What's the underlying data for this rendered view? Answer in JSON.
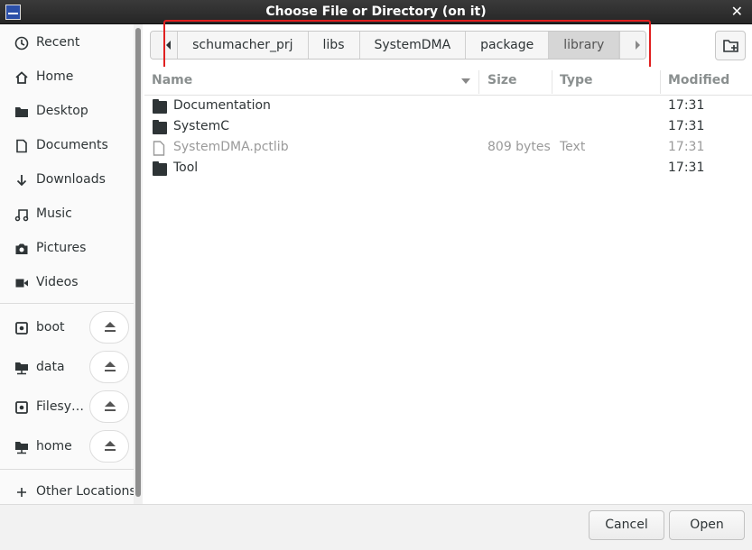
{
  "window": {
    "title": "Choose File or Directory (on it)",
    "close_glyph": "✕"
  },
  "sidebar": {
    "places": [
      {
        "label": "Recent",
        "icon": "clock-icon"
      },
      {
        "label": "Home",
        "icon": "home-icon"
      },
      {
        "label": "Desktop",
        "icon": "folder-icon"
      },
      {
        "label": "Documents",
        "icon": "document-icon"
      },
      {
        "label": "Downloads",
        "icon": "download-arrow-icon"
      },
      {
        "label": "Music",
        "icon": "music-note-icon"
      },
      {
        "label": "Pictures",
        "icon": "camera-icon"
      },
      {
        "label": "Videos",
        "icon": "film-icon"
      }
    ],
    "devices": [
      {
        "label": "boot",
        "icon": "drive-icon"
      },
      {
        "label": "data",
        "icon": "network-drive-icon"
      },
      {
        "label": "Filesy…",
        "icon": "drive-icon"
      },
      {
        "label": "home",
        "icon": "network-drive-icon"
      }
    ],
    "other_locations": {
      "label": "Other Locations",
      "icon": "plus-icon"
    }
  },
  "pathbar": {
    "crumbs": [
      "schumacher_prj",
      "libs",
      "SystemDMA",
      "package",
      "library"
    ],
    "active_index": 4
  },
  "filelist": {
    "columns": {
      "name": "Name",
      "size": "Size",
      "type": "Type",
      "modified": "Modified"
    },
    "rows": [
      {
        "name": "Documentation",
        "size": "",
        "type": "",
        "modified": "17:31",
        "kind": "folder"
      },
      {
        "name": "SystemC",
        "size": "",
        "type": "",
        "modified": "17:31",
        "kind": "folder"
      },
      {
        "name": "SystemDMA.pctlib",
        "size": "809 bytes",
        "type": "Text",
        "modified": "17:31",
        "kind": "file"
      },
      {
        "name": "Tool",
        "size": "",
        "type": "",
        "modified": "17:31",
        "kind": "folder"
      }
    ]
  },
  "buttons": {
    "cancel": "Cancel",
    "open": "Open"
  },
  "colors": {
    "titlebar": "#2b2b2b",
    "highlight_box": "#e02020",
    "active_crumb": "#d6d6d6"
  }
}
